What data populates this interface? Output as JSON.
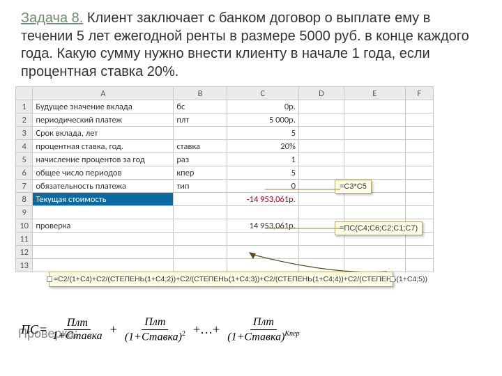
{
  "problem": {
    "lead": "Задача 8.",
    "text": " Клиент заключает с банком договор о выплате ему в течении 5 лет ежегодной ренты в размере 5000 руб. в конце каждого года. Какую сумму нужно внести клиенту в начале 1 года, если процентная ставка 20%."
  },
  "columns": [
    "A",
    "B",
    "C",
    "D",
    "E",
    "F"
  ],
  "rows": [
    {
      "n": "1",
      "a": "Будущее значение вклада",
      "b": "бс",
      "c": "0р."
    },
    {
      "n": "2",
      "a": "периодический платеж",
      "b": "плт",
      "c": "5 000р."
    },
    {
      "n": "3",
      "a": "Срок вклада, лет",
      "b": "",
      "c": "5"
    },
    {
      "n": "4",
      "a": "процентная ставка, год.",
      "b": "ставка",
      "c": "20%"
    },
    {
      "n": "5",
      "a": "начисление процентов за год",
      "b": "раз",
      "c": "1"
    },
    {
      "n": "6",
      "a": "общее число периодов",
      "b": "кпер",
      "c": "5"
    },
    {
      "n": "7",
      "a": "обязательность платежа",
      "b": "тип",
      "c": "0"
    },
    {
      "n": "8",
      "a": "Текущая стоимость",
      "b": "",
      "c": "-14 953,061р."
    },
    {
      "n": "9",
      "a": "",
      "b": "",
      "c": ""
    },
    {
      "n": "10",
      "a": "проверка",
      "b": "",
      "c": "14 953,061р."
    },
    {
      "n": "11",
      "a": "",
      "b": "",
      "c": ""
    },
    {
      "n": "12",
      "a": "",
      "b": "",
      "c": ""
    },
    {
      "n": "13",
      "a": "",
      "b": "",
      "c": ""
    }
  ],
  "formula1": "=C3*C5",
  "formula2": "=ПС(C4;C6;C2;C1;C7)",
  "long_formula": "=C2/(1+C4)+C2/(СТЕПЕНЬ(1+C4;2))+C2/(СТЕПЕНЬ(1+C4;3))+C2/(СТЕПЕНЬ(1+C4;4))+C2/(СТЕПЕНЬ(1+C4;5))",
  "proverka_label": "Проверка:",
  "eqn": {
    "lhs": "ПС",
    "eq": "=",
    "num": "Плт",
    "d1": "1+Ставка",
    "d2a": "(1+Ставка)",
    "d2b": "2",
    "dots": "+…+",
    "dk": "(1+Ставка)",
    "dkexp": "Кпер"
  }
}
